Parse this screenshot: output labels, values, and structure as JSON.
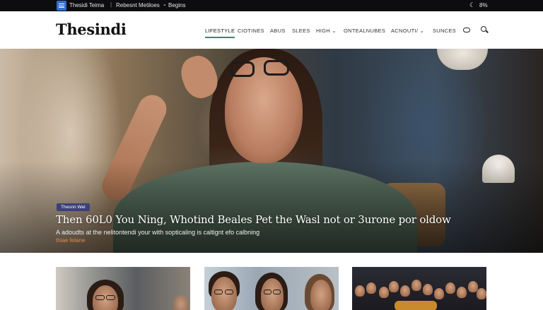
{
  "topbar": {
    "brand_icon": "list-icon",
    "text1": "Thesidi Teima",
    "separator": "|",
    "text2": "Rebesnt Metiloes",
    "caret": "⌄",
    "text3": "Begins",
    "theme_icon": "moon-icon",
    "right_text": "8%"
  },
  "header": {
    "brand": "Thesindi",
    "nav": [
      {
        "label": "LIFESTYLE",
        "active": true
      },
      {
        "label": "CIOTINES",
        "active": false
      },
      {
        "label": "ABUS",
        "active": false
      },
      {
        "label": "SLEES",
        "active": false
      },
      {
        "label": "HIGH",
        "caret": "⌄",
        "active": false
      },
      {
        "label": "ONTEALNUBES",
        "active": false
      },
      {
        "label": "ACNOUTI/",
        "caret": "⌄",
        "active": false
      },
      {
        "label": "SUNCES",
        "active": false
      }
    ],
    "toggle_icon": "toggle-icon",
    "search_icon": "search-icon"
  },
  "hero": {
    "tag": "Thesnn Wel",
    "title": "Then 60L0 You Ning, Whotind Beales  Pet the Wasl not or 3urone por oldow",
    "description": "A adoudts at the nelitontendi your with sopticaling is caltignt efo calbning",
    "link": "thiae felane"
  },
  "cards": [
    {
      "image": "woman-with-glasses-street"
    },
    {
      "image": "group-of-friends-glasses"
    },
    {
      "image": "crowd-of-people"
    }
  ],
  "colors": {
    "accent": "#2e8c77",
    "tag_bg": "#3b3f7a",
    "link": "#e08a4a",
    "topbar_bg": "#0d0d0f"
  }
}
